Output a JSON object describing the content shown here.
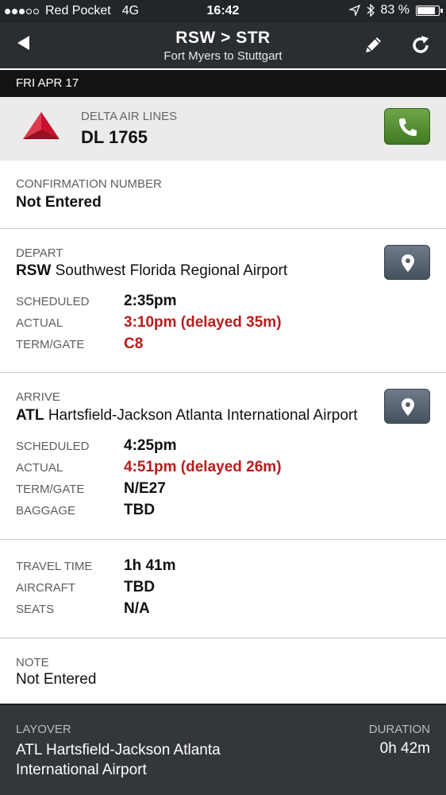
{
  "status_bar": {
    "carrier": "Red Pocket",
    "network": "4G",
    "time": "16:42",
    "battery": "83 %",
    "icons": [
      "location-arrow-icon",
      "bluetooth-icon",
      "battery-icon"
    ]
  },
  "nav": {
    "title": "RSW > STR",
    "subtitle": "Fort Myers to Stuttgart",
    "icons": [
      "back-arrow-icon",
      "pencil-icon",
      "refresh-icon"
    ]
  },
  "date": "FRI APR 17",
  "airline": {
    "name": "DELTA AIR LINES",
    "flight": "DL 1765",
    "icons": [
      "delta-logo",
      "phone-icon"
    ],
    "call_button_color": "#4f8c30"
  },
  "confirmation": {
    "label": "CONFIRMATION NUMBER",
    "value": "Not Entered"
  },
  "depart": {
    "label": "DEPART",
    "code": "RSW",
    "airport": "Southwest Florida Regional Airport",
    "rows": [
      {
        "label": "SCHEDULED",
        "value": "2:35pm"
      },
      {
        "label": "ACTUAL",
        "value": "3:10pm (delayed 35m)"
      },
      {
        "label": "TERM/GATE",
        "value": "C8"
      }
    ]
  },
  "arrive": {
    "label": "ARRIVE",
    "code": "ATL",
    "airport": "Hartsfield-Jackson Atlanta International Airport",
    "rows": [
      {
        "label": "SCHEDULED",
        "value": "4:25pm"
      },
      {
        "label": "ACTUAL",
        "value": "4:51pm (delayed 26m)"
      },
      {
        "label": "TERM/GATE",
        "value": "N/E27"
      },
      {
        "label": "BAGGAGE",
        "value": "TBD"
      }
    ]
  },
  "details": {
    "rows": [
      {
        "label": "TRAVEL TIME",
        "value": "1h 41m"
      },
      {
        "label": "AIRCRAFT",
        "value": "TBD"
      },
      {
        "label": "SEATS",
        "value": "N/A"
      }
    ]
  },
  "note": {
    "label": "NOTE",
    "value": "Not Entered"
  },
  "layover": {
    "label": "LAYOVER",
    "airport": "ATL Hartsfield-Jackson Atlanta International Airport",
    "duration_label": "DURATION",
    "duration": "0h 42m"
  },
  "colors": {
    "delay_red": "#b81c1c",
    "navbar": "#2a2d31",
    "delta_red": "#c8102e"
  }
}
